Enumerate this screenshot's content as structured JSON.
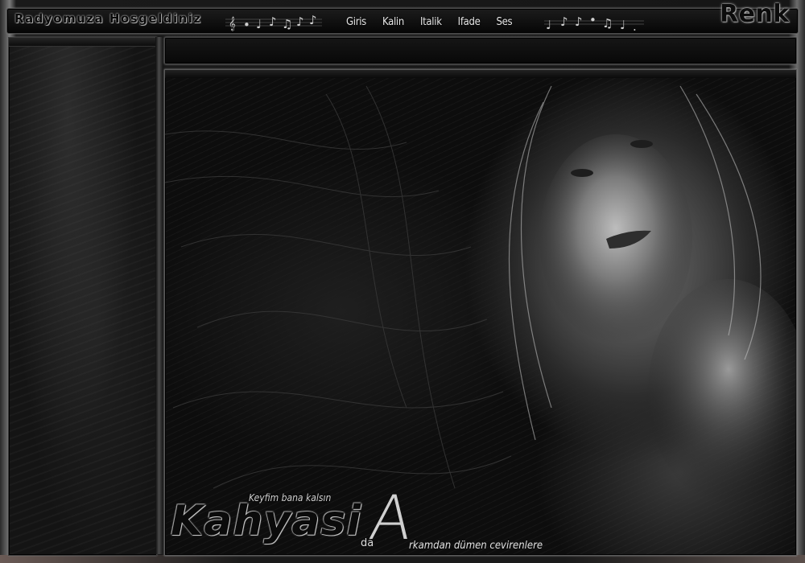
{
  "header": {
    "welcome": "Radyomuza Hosgeldiniz",
    "menu": [
      "Giris",
      "Kalin",
      "Italik",
      "Ifade",
      "Ses"
    ],
    "renk_label": "Renk"
  },
  "banner": {
    "tagline": "Keyfim bana kalsın",
    "brand_main": "Kahyasi",
    "brand_connector": "da",
    "brand_initial": "A",
    "brand_rest": "rkamdan dümen cevirenlere"
  },
  "icons": {
    "left_notes": "music-notes-icon",
    "right_notes": "music-notes-icon"
  },
  "colors": {
    "background": "#0b0b0b",
    "frame": "#4a4a4a",
    "text_light": "#e6e6e6"
  }
}
